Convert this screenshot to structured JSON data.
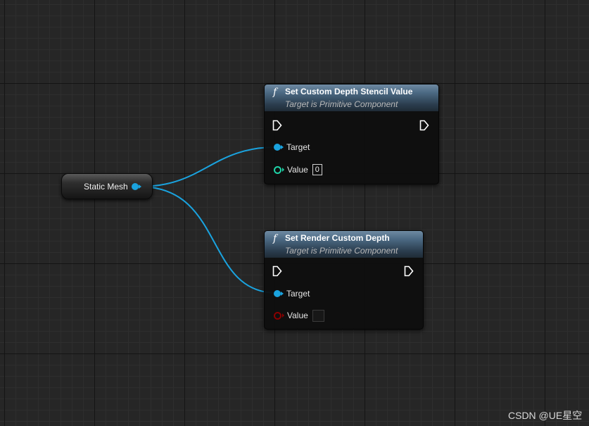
{
  "variable_node": {
    "label": "Static Mesh"
  },
  "nodes": [
    {
      "title": "Set Custom Depth Stencil Value",
      "subtitle": "Target is Primitive Component",
      "icon": "f",
      "target_label": "Target",
      "value_label": "Value",
      "value": "0"
    },
    {
      "title": "Set Render Custom Depth",
      "subtitle": "Target is Primitive Component",
      "icon": "f",
      "target_label": "Target",
      "value_label": "Value",
      "value_checked": false
    }
  ],
  "colors": {
    "object_pin": "#1aa3df",
    "int_pin": "#1fd4a8",
    "bool_pin": "#8a0000",
    "exec_pin": "#ffffff"
  },
  "watermark": "CSDN @UE星空"
}
